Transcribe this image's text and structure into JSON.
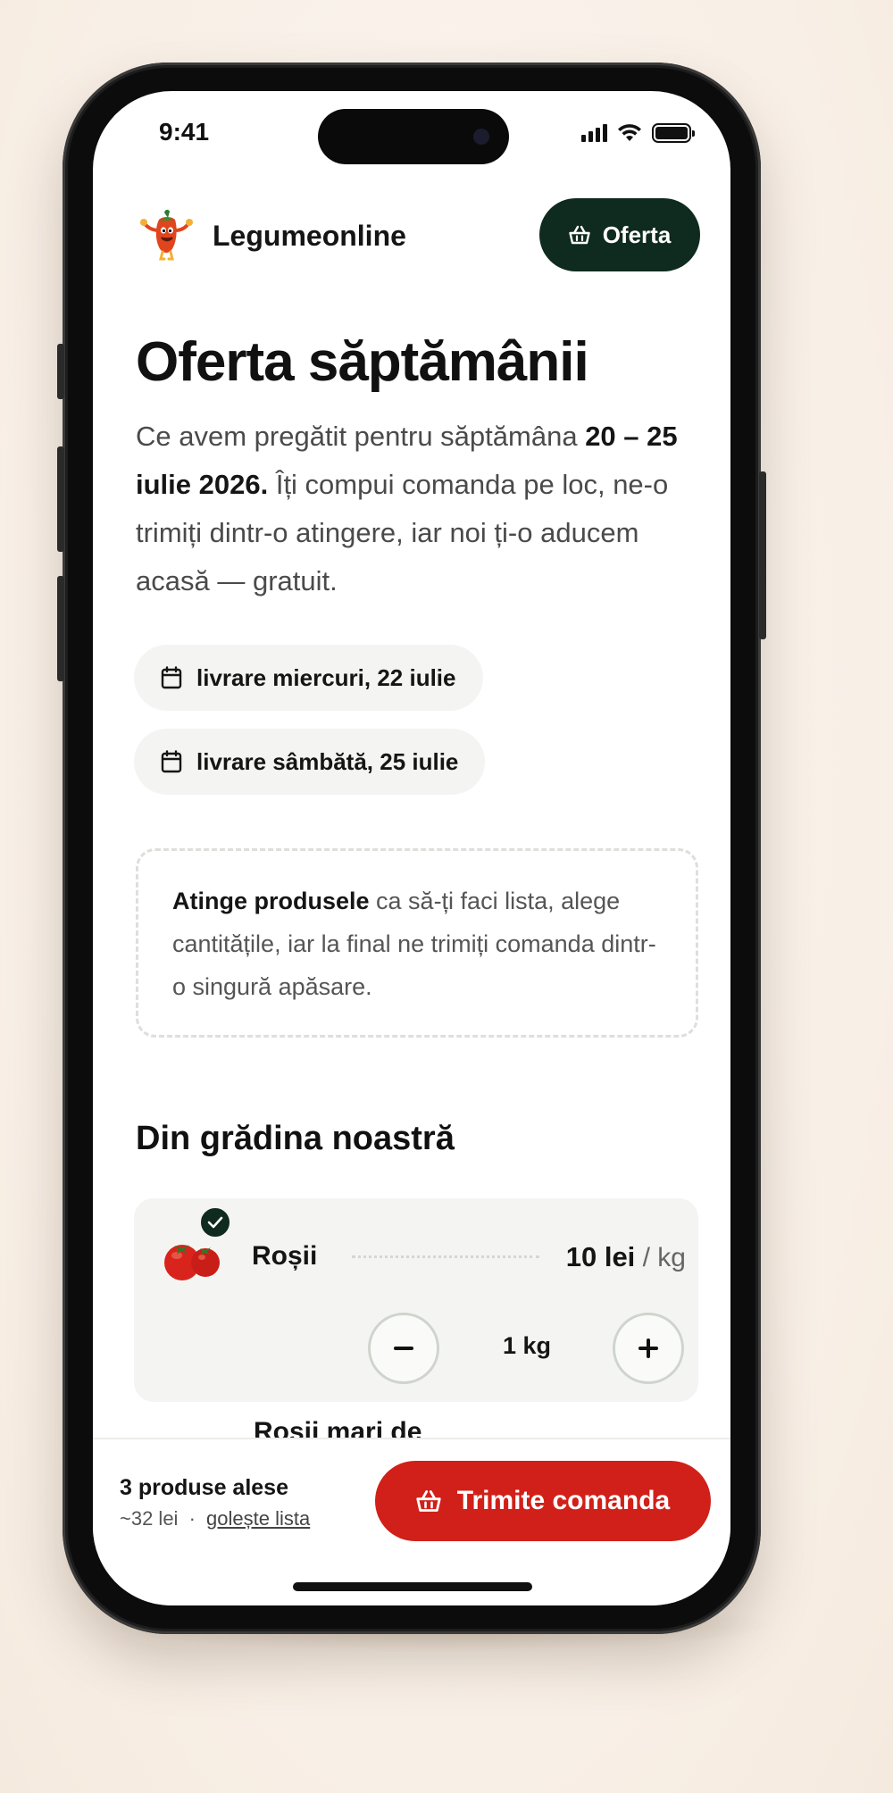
{
  "status_bar": {
    "time": "9:41"
  },
  "header": {
    "brand": "Legumeonline",
    "offer_button": "Oferta"
  },
  "page": {
    "title": "Oferta săptămânii",
    "lede_prefix": "Ce avem pregătit pentru săptămâna ",
    "lede_dates": "20 – 25 iulie 2026.",
    "lede_suffix": " Îți compui comanda pe loc, ne-o trimiți dintr-o atingere, iar noi ți-o aducem acasă — gratuit."
  },
  "delivery_pills": [
    {
      "label": "livrare miercuri, 22 iulie"
    },
    {
      "label": "livrare sâmbătă, 25 iulie"
    }
  ],
  "hint": {
    "bold": "Atinge produsele",
    "text": " ca să-ți faci lista, alege cantitățile, iar la final ne trimiți comanda dintr-o singură apăsare."
  },
  "section": {
    "title": "Din grădina noastră"
  },
  "products": [
    {
      "name": "Roșii",
      "price": "10 lei",
      "unit": "/ kg",
      "quantity": "1 kg",
      "selected": true
    }
  ],
  "next_product_peek": "Roșii mari de",
  "bottom_bar": {
    "count": "3 produse alese",
    "estimate": "~32 lei",
    "separator": "·",
    "clear_link": "golește lista",
    "send_button": "Trimite comanda"
  },
  "colors": {
    "accent_dark": "#0f2a1e",
    "accent_red": "#d12019",
    "card_bg": "#f4f5f2"
  }
}
